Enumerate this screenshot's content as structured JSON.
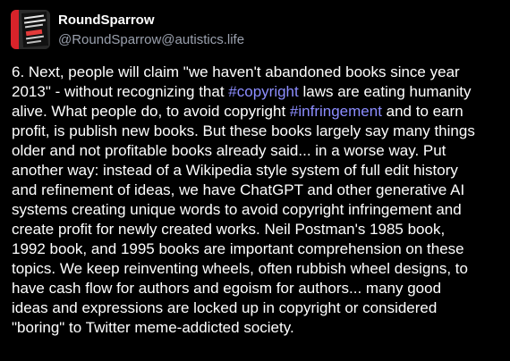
{
  "author": {
    "display_name": "RoundSparrow",
    "handle": "@RoundSparrow@autistics.life",
    "avatar_icon": "book-cover-avatar"
  },
  "colors": {
    "background": "#000000",
    "text": "#ffffff",
    "handle": "#9aa0ad",
    "hashtag": "#8c8dff"
  },
  "post": {
    "lines": [
      {
        "segments": [
          {
            "type": "text",
            "value": "6. Next, people will claim \"we haven't abandoned books since year"
          }
        ]
      },
      {
        "segments": [
          {
            "type": "text",
            "value": "2013\" - without recognizing that "
          },
          {
            "type": "hashtag",
            "value": "#copyright"
          },
          {
            "type": "text",
            "value": " laws are eating humanity"
          }
        ]
      },
      {
        "segments": [
          {
            "type": "text",
            "value": "alive. What people do, to avoid copyright "
          },
          {
            "type": "hashtag",
            "value": "#infringement"
          },
          {
            "type": "text",
            "value": " and to earn"
          }
        ]
      },
      {
        "segments": [
          {
            "type": "text",
            "value": "profit, is publish new books. But these books largely say many things"
          }
        ]
      },
      {
        "segments": [
          {
            "type": "text",
            "value": "older and not profitable books already said... in a worse way. Put"
          }
        ]
      },
      {
        "segments": [
          {
            "type": "text",
            "value": "another way: instead of a Wikipedia style system of full edit history"
          }
        ]
      },
      {
        "segments": [
          {
            "type": "text",
            "value": "and refinement of ideas, we have ChatGPT and other generative AI"
          }
        ]
      },
      {
        "segments": [
          {
            "type": "text",
            "value": "systems creating unique words to avoid copyright infringement and"
          }
        ]
      },
      {
        "segments": [
          {
            "type": "text",
            "value": "create profit for newly created works.  Neil Postman's 1985 book,"
          }
        ]
      },
      {
        "segments": [
          {
            "type": "text",
            "value": "1992 book, and 1995 books are important comprehension on these"
          }
        ]
      },
      {
        "segments": [
          {
            "type": "text",
            "value": "topics. We keep reinventing wheels, often rubbish wheel designs, to"
          }
        ]
      },
      {
        "segments": [
          {
            "type": "text",
            "value": "have cash flow for authors and egoism for authors... many good"
          }
        ]
      },
      {
        "segments": [
          {
            "type": "text",
            "value": "ideas and expressions are locked up in copyright or considered"
          }
        ]
      },
      {
        "segments": [
          {
            "type": "text",
            "value": "\"boring\" to Twitter meme-addicted society."
          }
        ]
      }
    ]
  }
}
